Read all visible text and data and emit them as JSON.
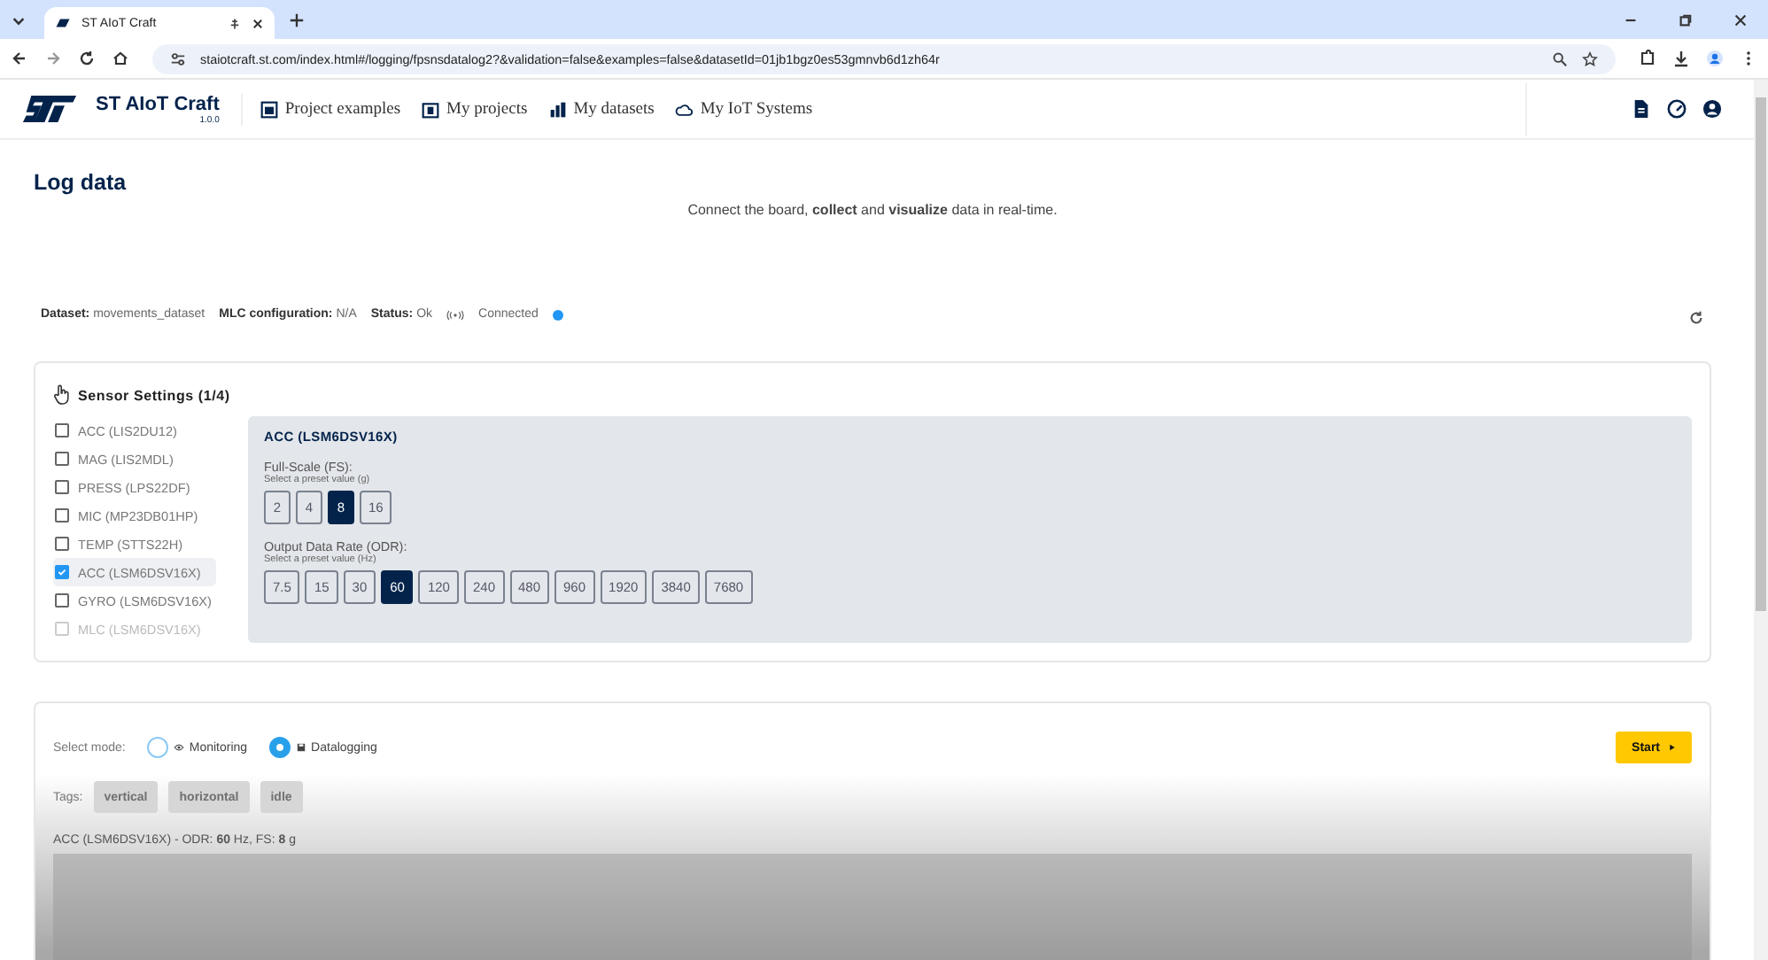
{
  "browser": {
    "tab_title": "ST AIoT Craft",
    "url": "staiotcraft.st.com/index.html#/logging/fpsnsdatalog2?&validation=false&examples=false&datasetId=01jb1bgz0es53gmnvb6d1zh64r"
  },
  "app": {
    "name": "ST AIoT Craft",
    "version": "1.0.0",
    "nav": [
      {
        "label": "Project examples",
        "kind": "examples"
      },
      {
        "label": "My projects",
        "kind": "projects"
      },
      {
        "label": "My datasets",
        "kind": "datasets"
      },
      {
        "label": "My IoT Systems",
        "kind": "cloud"
      }
    ]
  },
  "page": {
    "title": "Log data",
    "subtitle": "Connect the board, **collect** and **visualize** data in real-time."
  },
  "info": {
    "dataset_label": "Dataset:",
    "dataset": "movements_dataset",
    "mlc_label": "MLC configuration:",
    "mlc": "N/A",
    "status_label": "Status:",
    "status": "Ok",
    "connection": "Connected",
    "connected": true
  },
  "sensor_settings": {
    "title": "Sensor Settings (1/4)",
    "sensors": [
      {
        "label": "ACC (LIS2DU12)",
        "checked": false,
        "selected": false,
        "disabled": false
      },
      {
        "label": "MAG (LIS2MDL)",
        "checked": false,
        "selected": false,
        "disabled": false
      },
      {
        "label": "PRESS (LPS22DF)",
        "checked": false,
        "selected": false,
        "disabled": false
      },
      {
        "label": "MIC (MP23DB01HP)",
        "checked": false,
        "selected": false,
        "disabled": false
      },
      {
        "label": "TEMP (STTS22H)",
        "checked": false,
        "selected": false,
        "disabled": false
      },
      {
        "label": "ACC (LSM6DSV16X)",
        "checked": true,
        "selected": true,
        "disabled": false
      },
      {
        "label": "GYRO (LSM6DSV16X)",
        "checked": false,
        "selected": false,
        "disabled": false
      },
      {
        "label": "MLC (LSM6DSV16X)",
        "checked": false,
        "selected": false,
        "disabled": true
      }
    ],
    "panel": {
      "title": "ACC (LSM6DSV16X)",
      "groups": [
        {
          "label": "Full-Scale (FS):",
          "hint": "Select a preset value (g)",
          "options": [
            {
              "label": "2",
              "selected": false
            },
            {
              "label": "4",
              "selected": false
            },
            {
              "label": "8",
              "selected": true
            },
            {
              "label": "16",
              "selected": false
            }
          ]
        },
        {
          "label": "Output Data Rate (ODR):",
          "hint": "Select a preset value (Hz)",
          "options": [
            {
              "label": "7.5",
              "selected": false
            },
            {
              "label": "15",
              "selected": false
            },
            {
              "label": "30",
              "selected": false
            },
            {
              "label": "60",
              "selected": true
            },
            {
              "label": "120",
              "selected": false
            },
            {
              "label": "240",
              "selected": false
            },
            {
              "label": "480",
              "selected": false
            },
            {
              "label": "960",
              "selected": false
            },
            {
              "label": "1920",
              "selected": false
            },
            {
              "label": "3840",
              "selected": false
            },
            {
              "label": "7680",
              "selected": false
            }
          ]
        }
      ]
    }
  },
  "logging": {
    "mode_label": "Select mode:",
    "modes": [
      {
        "label": "Monitoring",
        "kind": "eye",
        "selected": false
      },
      {
        "label": "Datalogging",
        "kind": "disk",
        "selected": true
      }
    ],
    "start": "Start",
    "tags_label": "Tags:",
    "tags": [
      {
        "label": "vertical",
        "disabled": true
      },
      {
        "label": "horizontal",
        "disabled": true
      },
      {
        "label": "idle",
        "disabled": true
      }
    ],
    "plot_caption": "ACC (LSM6DSV16X) - ODR: **60** Hz, FS: **8** g"
  }
}
